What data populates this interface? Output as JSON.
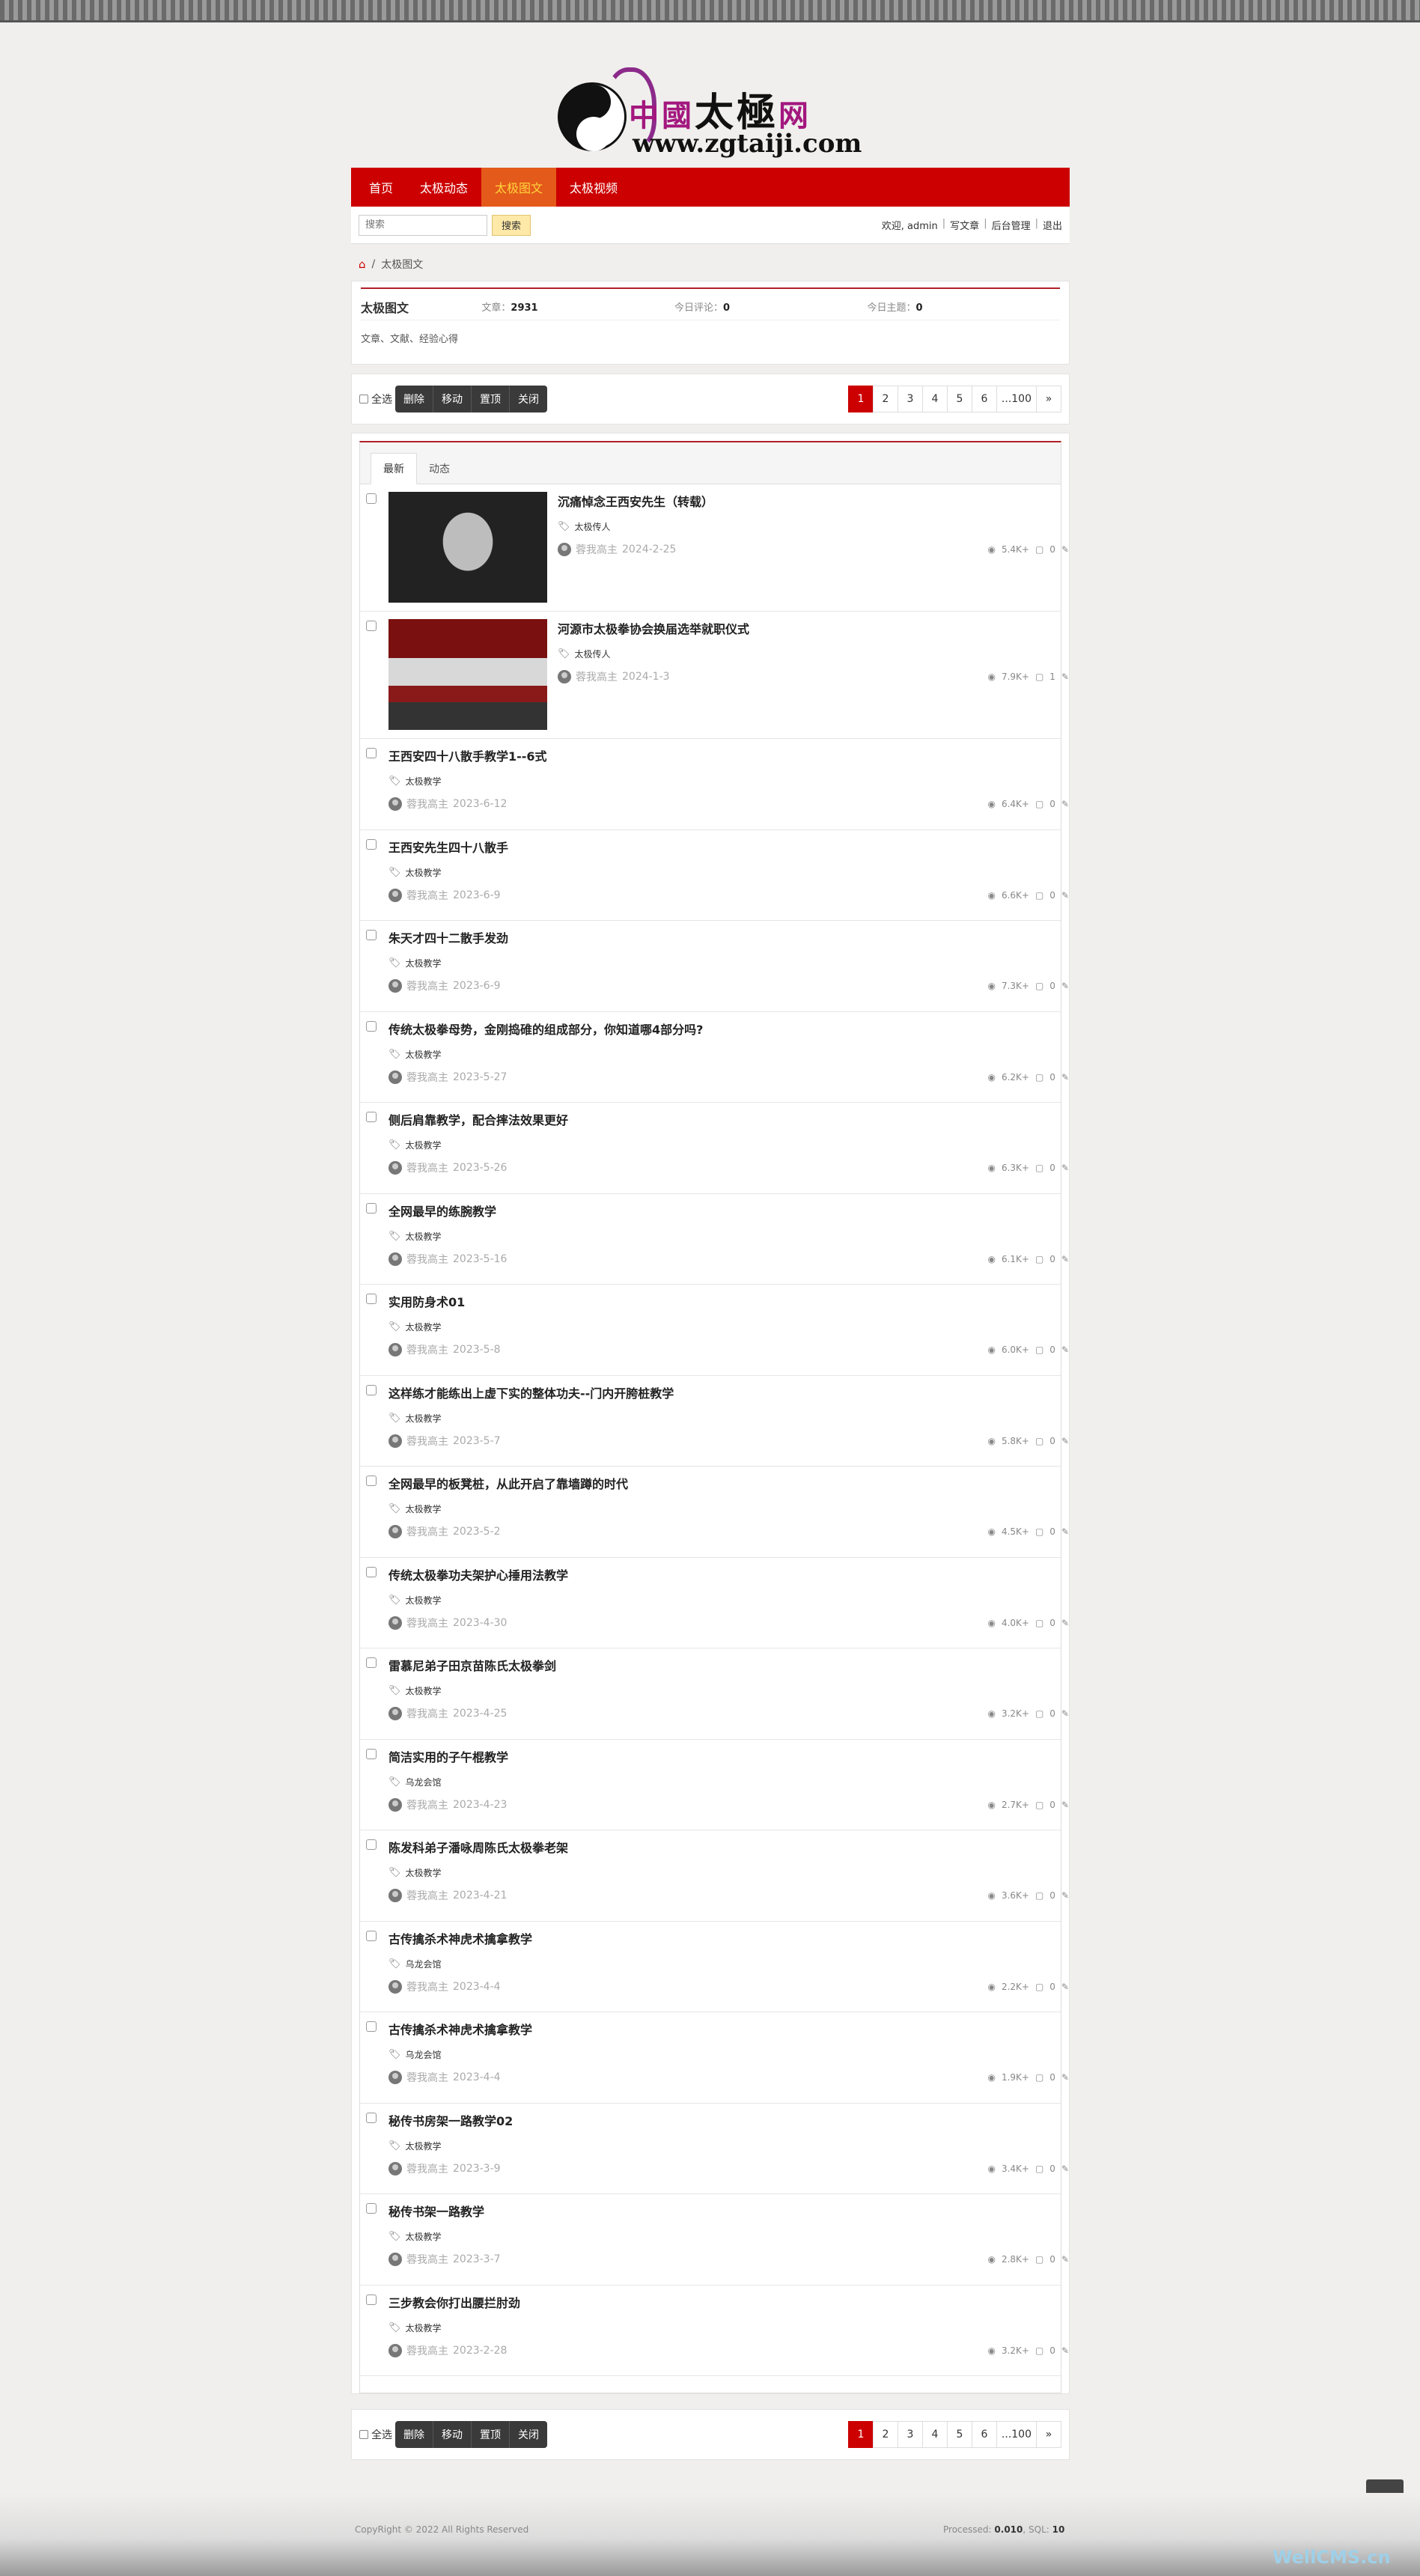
{
  "logo": {
    "title_a": "中國",
    "title_b": "太極",
    "title_c": "网",
    "title_d": "太",
    "url": "www.zgtaiji.com"
  },
  "nav": [
    {
      "label": "首页"
    },
    {
      "label": "太极动态"
    },
    {
      "label": "太极图文"
    },
    {
      "label": "太极视频"
    }
  ],
  "toolbar": {
    "search_placeholder": "搜索",
    "search_button": "搜索",
    "welcome": "欢迎, admin",
    "write": "写文章",
    "admin": "后台管理",
    "logout": "退出",
    "sep": "|"
  },
  "breadcrumb": {
    "current": "太极图文",
    "sep": "/"
  },
  "forum": {
    "name": "太极图文",
    "articles_label": "文章：",
    "articles": "2931",
    "today_comments_label": "今日评论：",
    "today_comments": "0",
    "today_topics_label": "今日主题：",
    "today_topics": "0",
    "description": "文章、文献、经验心得"
  },
  "actions": {
    "select_all": "全选",
    "delete": "删除",
    "move": "移动",
    "pin": "置顶",
    "close": "关闭"
  },
  "pager": [
    "1",
    "2",
    "3",
    "4",
    "5",
    "6",
    "...100",
    "»"
  ],
  "tabs": [
    {
      "label": "最新"
    },
    {
      "label": "动态"
    }
  ],
  "threads": [
    {
      "title": "沉痛悼念王西安先生（转载）",
      "tag": "太极传人",
      "author": "蓉我高主",
      "date": "2024-2-25",
      "views": "5.4K+",
      "comments": "0",
      "thumb": "portrait"
    },
    {
      "title": "河源市太极拳协会换届选举就职仪式",
      "tag": "太极传人",
      "author": "蓉我高主",
      "date": "2024-1-3",
      "views": "7.9K+",
      "comments": "1",
      "thumb": "event"
    },
    {
      "title": "王西安四十八散手教学1--6式",
      "tag": "太极教学",
      "author": "蓉我高主",
      "date": "2023-6-12",
      "views": "6.4K+",
      "comments": "0"
    },
    {
      "title": "王西安先生四十八散手",
      "tag": "太极教学",
      "author": "蓉我高主",
      "date": "2023-6-9",
      "views": "6.6K+",
      "comments": "0"
    },
    {
      "title": "朱天才四十二散手发劲",
      "tag": "太极教学",
      "author": "蓉我高主",
      "date": "2023-6-9",
      "views": "7.3K+",
      "comments": "0"
    },
    {
      "title": "传统太极拳母势，金刚捣碓的组成部分，你知道哪4部分吗?",
      "tag": "太极教学",
      "author": "蓉我高主",
      "date": "2023-5-27",
      "views": "6.2K+",
      "comments": "0"
    },
    {
      "title": "侧后肩靠教学，配合摔法效果更好",
      "tag": "太极教学",
      "author": "蓉我高主",
      "date": "2023-5-26",
      "views": "6.3K+",
      "comments": "0"
    },
    {
      "title": "全网最早的练腕教学",
      "tag": "太极教学",
      "author": "蓉我高主",
      "date": "2023-5-16",
      "views": "6.1K+",
      "comments": "0"
    },
    {
      "title": "实用防身术01",
      "tag": "太极教学",
      "author": "蓉我高主",
      "date": "2023-5-8",
      "views": "6.0K+",
      "comments": "0"
    },
    {
      "title": "这样练才能练出上虚下实的整体功夫--门内开胯桩教学",
      "tag": "太极教学",
      "author": "蓉我高主",
      "date": "2023-5-7",
      "views": "5.8K+",
      "comments": "0"
    },
    {
      "title": "全网最早的板凳桩，从此开启了靠墙蹲的时代",
      "tag": "太极教学",
      "author": "蓉我高主",
      "date": "2023-5-2",
      "views": "4.5K+",
      "comments": "0"
    },
    {
      "title": "传统太极拳功夫架护心捶用法教学",
      "tag": "太极教学",
      "author": "蓉我高主",
      "date": "2023-4-30",
      "views": "4.0K+",
      "comments": "0"
    },
    {
      "title": "雷慕尼弟子田京苗陈氏太极拳剑",
      "tag": "太极教学",
      "author": "蓉我高主",
      "date": "2023-4-25",
      "views": "3.2K+",
      "comments": "0"
    },
    {
      "title": "简洁实用的子午棍教学",
      "tag": "乌龙会馆",
      "author": "蓉我高主",
      "date": "2023-4-23",
      "views": "2.7K+",
      "comments": "0"
    },
    {
      "title": "陈发科弟子潘咏周陈氏太极拳老架",
      "tag": "太极教学",
      "author": "蓉我高主",
      "date": "2023-4-21",
      "views": "3.6K+",
      "comments": "0"
    },
    {
      "title": "古传擒杀术神虎术擒拿教学",
      "tag": "乌龙会馆",
      "author": "蓉我高主",
      "date": "2023-4-4",
      "views": "2.2K+",
      "comments": "0"
    },
    {
      "title": "古传擒杀术神虎术擒拿教学",
      "tag": "乌龙会馆",
      "author": "蓉我高主",
      "date": "2023-4-4",
      "views": "1.9K+",
      "comments": "0"
    },
    {
      "title": "秘传书房架一路教学02",
      "tag": "太极教学",
      "author": "蓉我高主",
      "date": "2023-3-9",
      "views": "3.4K+",
      "comments": "0"
    },
    {
      "title": "秘传书架一路教学",
      "tag": "太极教学",
      "author": "蓉我高主",
      "date": "2023-3-7",
      "views": "2.8K+",
      "comments": "0"
    },
    {
      "title": "三步教会你打出腰拦肘劲",
      "tag": "太极教学",
      "author": "蓉我高主",
      "date": "2023-2-28",
      "views": "3.2K+",
      "comments": "0"
    }
  ],
  "footer": {
    "copyright": "CopyRight © 2022 All Rights Reserved",
    "processed_label": "Processed:",
    "processed": "0.010",
    "sql_label": ", SQL:",
    "sql": "10",
    "watermark": "WellCMS.cn"
  },
  "icons": {
    "views": "eye-icon",
    "comments": "comment-icon",
    "edit": "edit-icon",
    "tag": "tag-icon",
    "home": "home-icon",
    "back_top": "chevron-up-icon"
  },
  "colors": {
    "brand_red": "#cc0000",
    "active_nav": "#e45a1a",
    "active_nav_text": "#ffd53d"
  }
}
